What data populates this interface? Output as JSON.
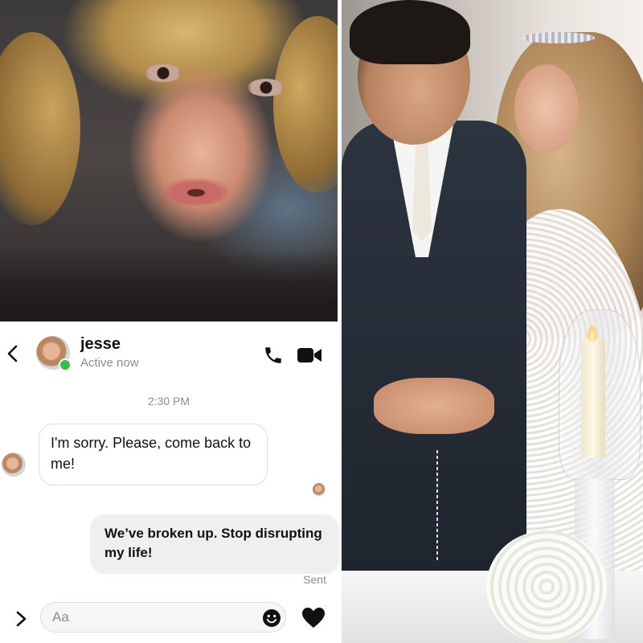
{
  "chat": {
    "contact_name": "jesse",
    "contact_status": "Active now",
    "timestamp": "2:30 PM",
    "messages": [
      {
        "direction": "incoming",
        "text": "I'm sorry. Please, come back to me!"
      },
      {
        "direction": "outgoing",
        "text": "We’ve broken up. Stop disrupting my life!"
      }
    ],
    "delivery_status": "Sent",
    "input": {
      "placeholder": "Aa",
      "value": ""
    },
    "icons": {
      "back": "chevron-left-icon",
      "call": "phone-icon",
      "video": "video-camera-icon",
      "expand": "chevron-right-icon",
      "emoji": "emoji-icon",
      "like": "heart-icon"
    },
    "colors": {
      "online": "#31c24d",
      "outgoing_bubble": "#efefef",
      "muted_text": "#8a8d91"
    }
  },
  "photos": [
    {
      "id": "crying-man-photo"
    },
    {
      "id": "wedding-ceremony-photo"
    }
  ]
}
